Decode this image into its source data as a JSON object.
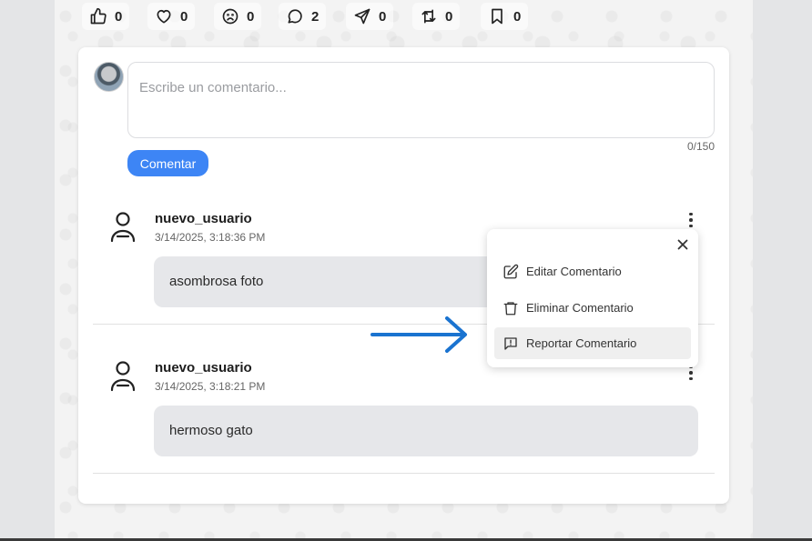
{
  "reactions": [
    {
      "icon": "thumbs-up-icon",
      "count": "0"
    },
    {
      "icon": "heart-icon",
      "count": "0"
    },
    {
      "icon": "sad-face-icon",
      "count": "0"
    },
    {
      "icon": "comment-bubble-icon",
      "count": "2"
    },
    {
      "icon": "send-icon",
      "count": "0"
    },
    {
      "icon": "repost-icon",
      "count": "0"
    },
    {
      "icon": "bookmark-icon",
      "count": "0"
    }
  ],
  "composer": {
    "placeholder": "Escribe un comentario...",
    "value": "",
    "counter": "0/150",
    "button_label": "Comentar"
  },
  "comments": [
    {
      "author": "nuevo_usuario",
      "timestamp": "3/14/2025, 3:18:36 PM",
      "text": "asombrosa foto"
    },
    {
      "author": "nuevo_usuario",
      "timestamp": "3/14/2025, 3:18:21 PM",
      "text": "hermoso gato"
    }
  ],
  "menu": {
    "items": [
      {
        "label": "Editar Comentario",
        "icon": "edit-icon"
      },
      {
        "label": "Eliminar Comentario",
        "icon": "trash-icon"
      },
      {
        "label": "Reportar Comentario",
        "icon": "report-icon"
      }
    ],
    "highlighted_index": 2
  },
  "colors": {
    "accent": "#3d85f5",
    "annotation_arrow": "#1a73d0"
  }
}
